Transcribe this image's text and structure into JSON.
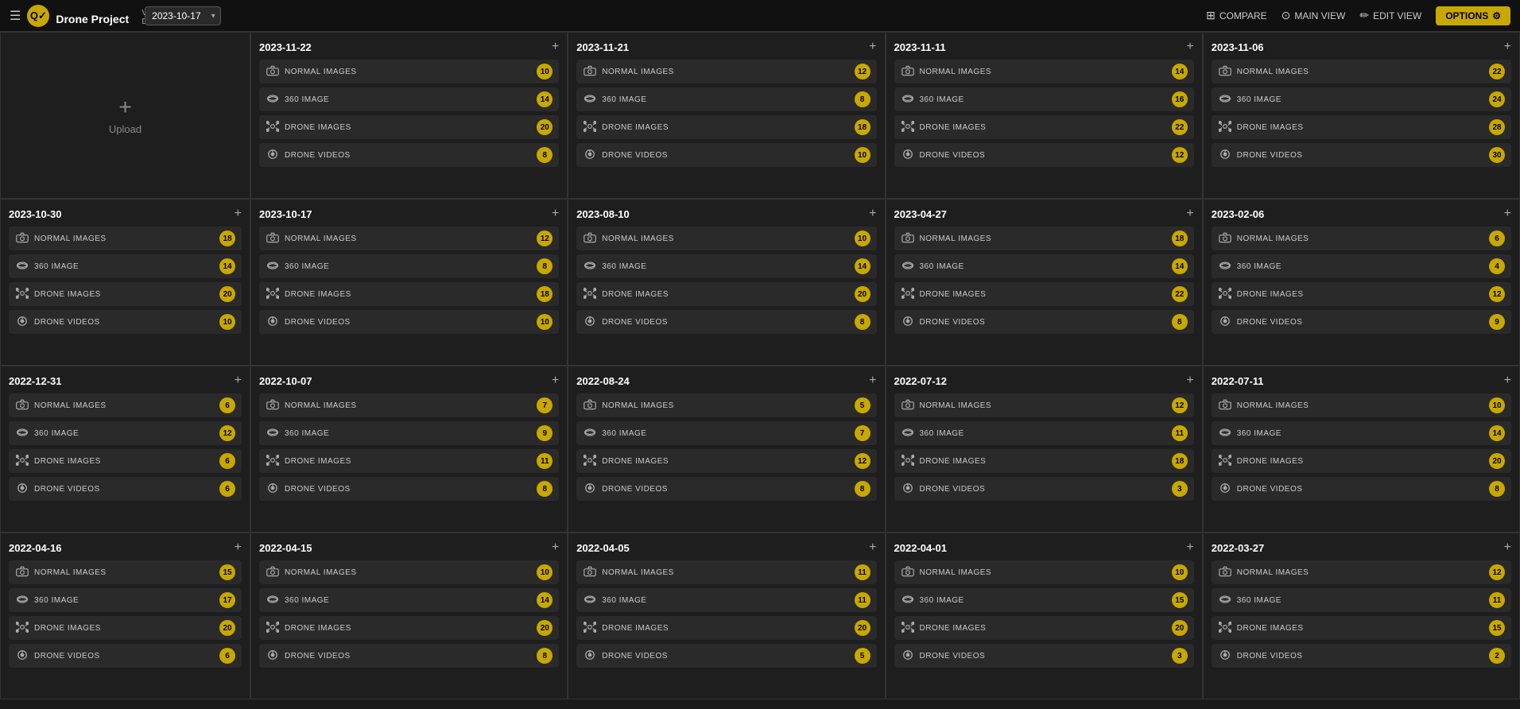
{
  "header": {
    "visit_label": "Visit D...",
    "project_name": "Drone Project",
    "selected_date": "2023-10-17",
    "compare_label": "COMPARE",
    "main_view_label": "MAIN VIEW",
    "edit_view_label": "EDIT VIEW",
    "options_label": "OPTIONS"
  },
  "upload_cell": {
    "plus": "+",
    "label": "Upload"
  },
  "item_types": [
    {
      "id": "normal",
      "label": "NORMAL IMAGES",
      "icon": "📷"
    },
    {
      "id": "360",
      "label": "360 IMAGE",
      "icon": "🔄"
    },
    {
      "id": "drone",
      "label": "DRONE IMAGES",
      "icon": "✈"
    },
    {
      "id": "video",
      "label": "DRONE VIDEOS",
      "icon": "📍"
    }
  ],
  "cells": [
    {
      "date": "2023-11-22",
      "counts": {
        "normal": 10,
        "360": 14,
        "drone": 20,
        "video": 8
      }
    },
    {
      "date": "2023-11-21",
      "counts": {
        "normal": 12,
        "360": 8,
        "drone": 18,
        "video": 10
      }
    },
    {
      "date": "2023-11-11",
      "counts": {
        "normal": 14,
        "360": 16,
        "drone": 22,
        "video": 12
      }
    },
    {
      "date": "2023-11-06",
      "counts": {
        "normal": 22,
        "360": 24,
        "drone": 28,
        "video": 30
      }
    },
    {
      "date": "2023-10-30",
      "counts": {
        "normal": 18,
        "360": 14,
        "drone": 20,
        "video": 10
      }
    },
    {
      "date": "2023-10-17",
      "counts": {
        "normal": 12,
        "360": 8,
        "drone": 18,
        "video": 10
      }
    },
    {
      "date": "2023-08-10",
      "counts": {
        "normal": 10,
        "360": 14,
        "drone": 20,
        "video": 8
      }
    },
    {
      "date": "2023-04-27",
      "counts": {
        "normal": 18,
        "360": 14,
        "drone": 22,
        "video": 8
      }
    },
    {
      "date": "2023-02-06",
      "counts": {
        "normal": 6,
        "360": 4,
        "drone": 12,
        "video": 9
      }
    },
    {
      "date": "2022-12-31",
      "counts": {
        "normal": 6,
        "360": 12,
        "drone": 6,
        "video": 6
      }
    },
    {
      "date": "2022-10-07",
      "counts": {
        "normal": 7,
        "360": 9,
        "drone": 11,
        "video": 8
      }
    },
    {
      "date": "2022-08-24",
      "counts": {
        "normal": 5,
        "360": 7,
        "drone": 12,
        "video": 8
      }
    },
    {
      "date": "2022-07-12",
      "counts": {
        "normal": 12,
        "360": 11,
        "drone": 18,
        "video": 3
      }
    },
    {
      "date": "2022-07-11",
      "counts": {
        "normal": 10,
        "360": 14,
        "drone": 20,
        "video": 8
      }
    },
    {
      "date": "2022-04-16",
      "counts": {
        "normal": 15,
        "360": 17,
        "drone": 20,
        "video": 6
      }
    },
    {
      "date": "2022-04-15",
      "counts": {
        "normal": 10,
        "360": 14,
        "drone": 20,
        "video": 8
      }
    },
    {
      "date": "2022-04-05",
      "counts": {
        "normal": 11,
        "360": 11,
        "drone": 20,
        "video": 5
      }
    },
    {
      "date": "2022-04-01",
      "counts": {
        "normal": 10,
        "360": 15,
        "drone": 20,
        "video": 3
      }
    },
    {
      "date": "2022-03-27",
      "counts": {
        "normal": 12,
        "360": 11,
        "drone": 15,
        "video": 2
      }
    }
  ]
}
